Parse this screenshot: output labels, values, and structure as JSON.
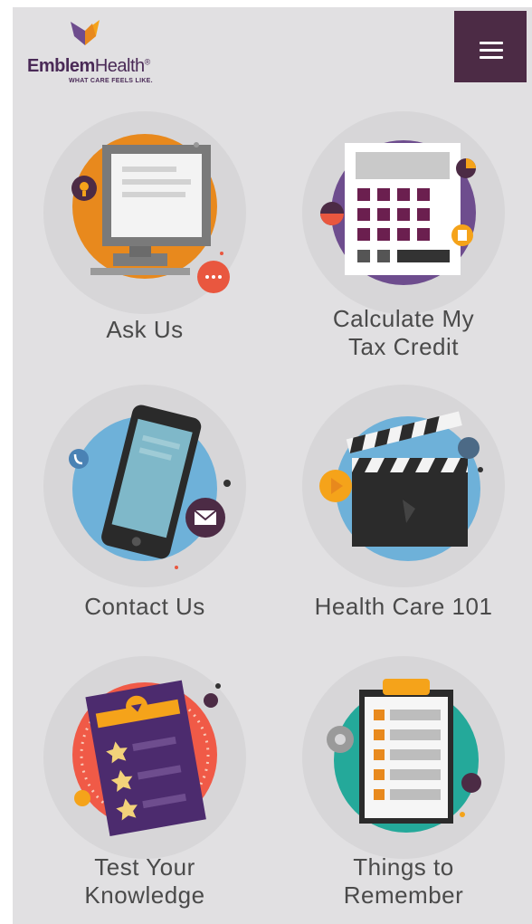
{
  "brand": {
    "name_bold": "Emblem",
    "name_regular": "Health",
    "registered": "®",
    "tagline": "WHAT CARE FEELS LIKE."
  },
  "menu": {
    "icon": "hamburger-menu-icon"
  },
  "tiles": [
    {
      "line1": "Ask Us",
      "line2": "",
      "icon": "computer-monitor-icon"
    },
    {
      "line1": "Calculate My",
      "line2": "Tax Credit",
      "icon": "calculator-icon"
    },
    {
      "line1": "Contact Us",
      "line2": "",
      "icon": "smartphone-icon"
    },
    {
      "line1": "Health Care 101",
      "line2": "",
      "icon": "clapperboard-icon"
    },
    {
      "line1": "Test Your",
      "line2": "Knowledge",
      "icon": "quiz-sheet-icon"
    },
    {
      "line1": "Things to",
      "line2": "Remember",
      "icon": "checklist-clipboard-icon"
    }
  ],
  "colors": {
    "background": "#e1e0e2",
    "menu_button": "#4c2b45",
    "brand_purple": "#4a2a57",
    "orange": "#e8891d",
    "purple": "#6e4d8e",
    "blue": "#6eb1d9",
    "teal": "#24a99a",
    "red": "#e9573f"
  }
}
